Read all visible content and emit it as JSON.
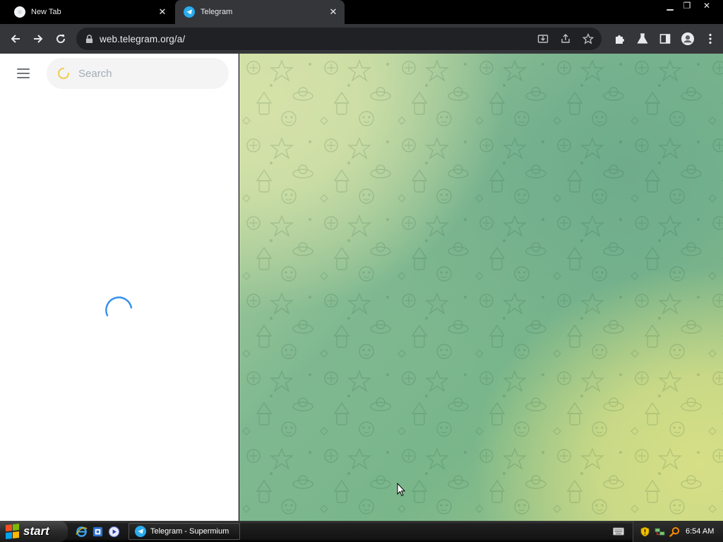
{
  "browser": {
    "tabs": [
      {
        "title": "New Tab",
        "active": false,
        "favicon": "newtab-icon"
      },
      {
        "title": "Telegram",
        "active": true,
        "favicon": "telegram-icon"
      }
    ],
    "url": "web.telegram.org/a/",
    "window_controls": [
      "minimize",
      "restore",
      "close"
    ]
  },
  "telegram": {
    "search": {
      "placeholder": "Search"
    },
    "colors": {
      "accent": "#3390ec",
      "search_spinner": "#f2cf5b",
      "background_light": "#d5e2a8",
      "background_green": "#7fb890",
      "background_yellow": "#d6df86"
    }
  },
  "taskbar": {
    "start_label": "start",
    "quicklaunch": [
      "ie-icon",
      "windows-update-icon",
      "media-player-icon"
    ],
    "task": {
      "label": "Telegram - Supermium"
    },
    "tray_icons": [
      "keyboard-icon",
      "security-shield-icon",
      "network-icon",
      "search-icon"
    ],
    "clock": "6:54 AM"
  }
}
